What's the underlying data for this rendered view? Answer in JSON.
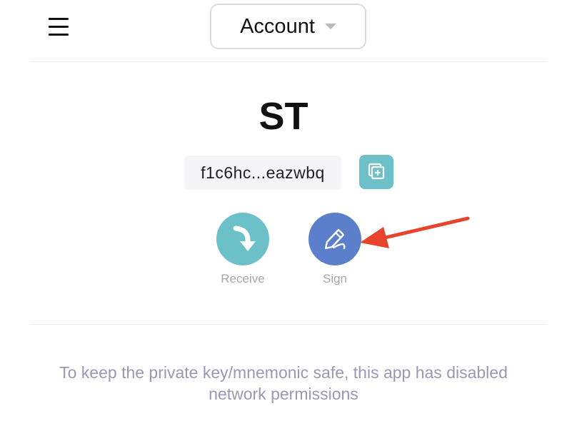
{
  "header": {
    "menu_icon": "hamburger-menu-icon",
    "account_select_label": "Account",
    "dropdown_icon": "caret-down-icon"
  },
  "account": {
    "name": "ST",
    "address": "f1c6hc...eazwbq",
    "copy_icon": "copy-add-icon"
  },
  "actions": {
    "receive": {
      "label": "Receive",
      "icon": "receive-arrow-icon",
      "color": "#6cc1c8"
    },
    "sign": {
      "label": "Sign",
      "icon": "pen-icon",
      "color": "#5b7fca"
    }
  },
  "annotation": {
    "arrow_color": "#e8432c"
  },
  "notice": {
    "text": "To keep the private key/mnemonic safe, this app has disabled network permissions"
  }
}
